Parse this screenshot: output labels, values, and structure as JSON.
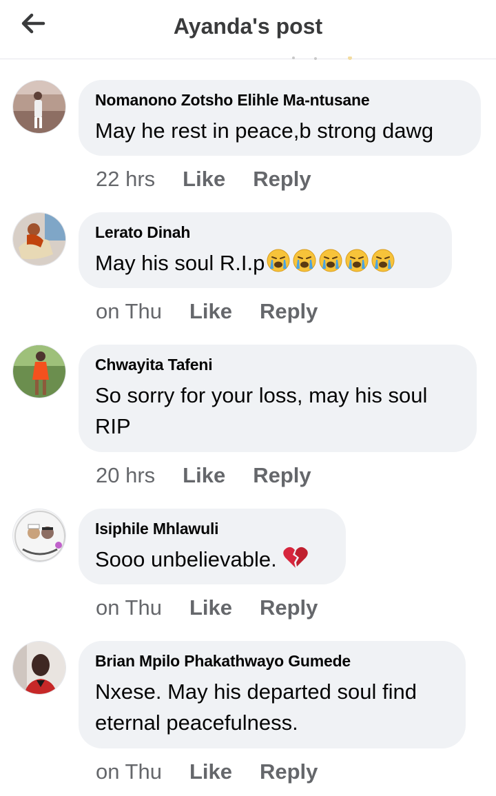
{
  "header": {
    "title": "Ayanda's post"
  },
  "comments": [
    {
      "author": "Nomanono Zotsho Elihle Ma-ntusane",
      "text": "May he rest in peace,b strong dawg",
      "time": "22 hrs",
      "like": "Like",
      "reply": "Reply"
    },
    {
      "author": "Lerato Dinah",
      "text": "May his soul R.I.p",
      "time": "on Thu",
      "like": "Like",
      "reply": "Reply",
      "emoji": [
        "crying-face-emoji",
        "crying-face-emoji",
        "crying-face-emoji",
        "crying-face-emoji",
        "crying-face-emoji"
      ]
    },
    {
      "author": "Chwayita Tafeni",
      "text_line1": "So sorry for your loss, may his soul",
      "text_line2": "RIP",
      "time": "20 hrs",
      "like": "Like",
      "reply": "Reply"
    },
    {
      "author": "Isiphile Mhlawuli",
      "text": "Sooo unbelievable.",
      "time": "on Thu",
      "like": "Like",
      "reply": "Reply",
      "emoji": [
        "broken-heart-emoji"
      ]
    },
    {
      "author": "Brian Mpilo Phakathwayo Gumede",
      "text_line1": "Nxese. May his departed soul find",
      "text_line2": "eternal peacefulness.",
      "time": "on Thu",
      "like": "Like",
      "reply": "Reply"
    }
  ],
  "colors": {
    "bubble": "#f0f2f5",
    "meta_text": "#65676b",
    "divider": "#e4e6eb",
    "emoji_face": "#f7c33a",
    "emoji_tears": "#4aa3e0",
    "broken_heart": "#d7263d"
  }
}
